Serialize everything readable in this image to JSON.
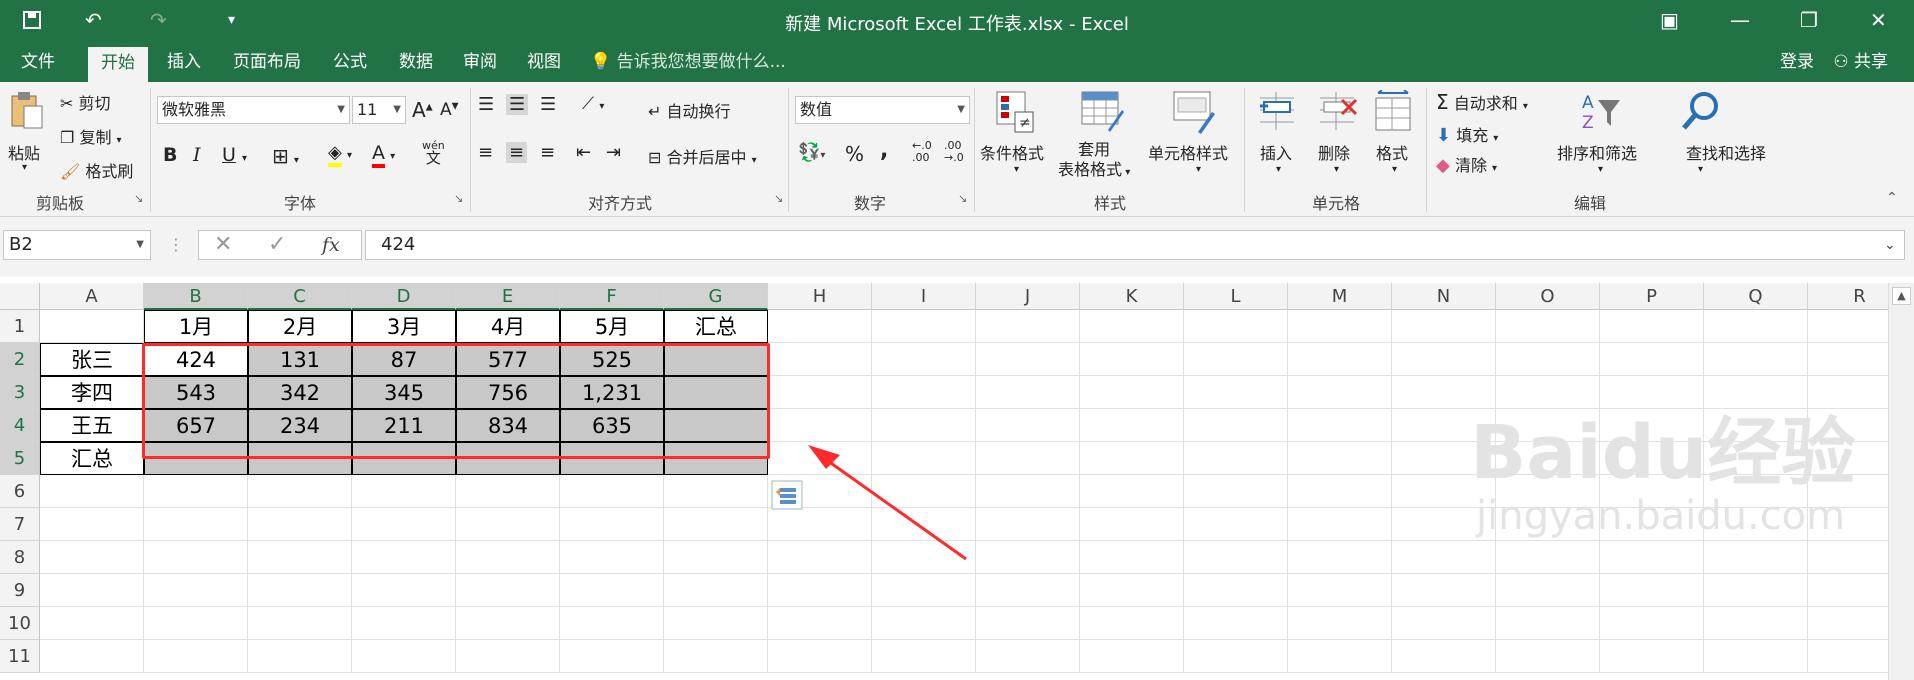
{
  "app": {
    "title": "新建 Microsoft Excel 工作表.xlsx - Excel",
    "undo_symbol": "↶",
    "redo_symbol": "↷",
    "qat_more_symbol": "▾",
    "window": {
      "restore_symbol": "▣",
      "minimize": "—",
      "maximize": "❐",
      "close": "✕"
    }
  },
  "menu": {
    "tabs": [
      "文件",
      "开始",
      "插入",
      "页面布局",
      "公式",
      "数据",
      "审阅",
      "视图"
    ],
    "active_tab": "开始",
    "tell_me": "告诉我您想要做什么...",
    "login": "登录",
    "share": "共享"
  },
  "ribbon": {
    "clipboard": {
      "label": "剪贴板",
      "paste": "粘贴",
      "cut": "剪切",
      "copy": "复制",
      "format_painter": "格式刷"
    },
    "font": {
      "label": "字体",
      "font_name": "微软雅黑",
      "font_size": "11",
      "bold": "B",
      "italic": "I",
      "underline": "U",
      "grow": "A",
      "shrink": "A",
      "phonetic": "wén"
    },
    "alignment": {
      "label": "对齐方式",
      "wrap_text": "自动换行",
      "merge_center": "合并后居中"
    },
    "number": {
      "label": "数字",
      "format": "数值",
      "percent": "%",
      "comma": ",",
      "inc_decimal": ".00",
      "dec_decimal": ".0"
    },
    "styles": {
      "label": "样式",
      "conditional": "条件格式",
      "table_l1": "套用",
      "table_l2": "表格格式",
      "cell_styles": "单元格样式"
    },
    "cells": {
      "label": "单元格",
      "insert": "插入",
      "delete": "删除",
      "format": "格式"
    },
    "editing": {
      "label": "编辑",
      "autosum": "自动求和",
      "fill": "填充",
      "clear": "清除",
      "sort_filter": "排序和筛选",
      "find_select": "查找和选择",
      "sigma": "Σ"
    }
  },
  "formula_bar": {
    "name_box": "B2",
    "fx": "fx",
    "cancel": "✕",
    "enter": "✓",
    "value": "424"
  },
  "sheet": {
    "columns": [
      "A",
      "B",
      "C",
      "D",
      "E",
      "F",
      "G",
      "H",
      "I",
      "J",
      "K",
      "L",
      "M",
      "N",
      "O",
      "P",
      "Q",
      "R"
    ],
    "rows": [
      "1",
      "2",
      "3",
      "4",
      "5",
      "6",
      "7",
      "8",
      "9",
      "10",
      "11"
    ],
    "header_row": [
      "",
      "1月",
      "2月",
      "3月",
      "4月",
      "5月",
      "汇总"
    ],
    "data": [
      [
        "张三",
        "424",
        "131",
        "87",
        "577",
        "525",
        ""
      ],
      [
        "李四",
        "543",
        "342",
        "345",
        "756",
        "1,231",
        ""
      ],
      [
        "王五",
        "657",
        "234",
        "211",
        "834",
        "635",
        ""
      ],
      [
        "汇总",
        "",
        "",
        "",
        "",
        "",
        ""
      ]
    ],
    "active_cell": "B2"
  },
  "watermark": {
    "brand": "Baidu经验",
    "url": "jingyan.baidu.com"
  },
  "colors": {
    "excel_green": "#217346",
    "selection_gray": "#c8c8c8",
    "annotation_red": "#ff2a2a"
  }
}
